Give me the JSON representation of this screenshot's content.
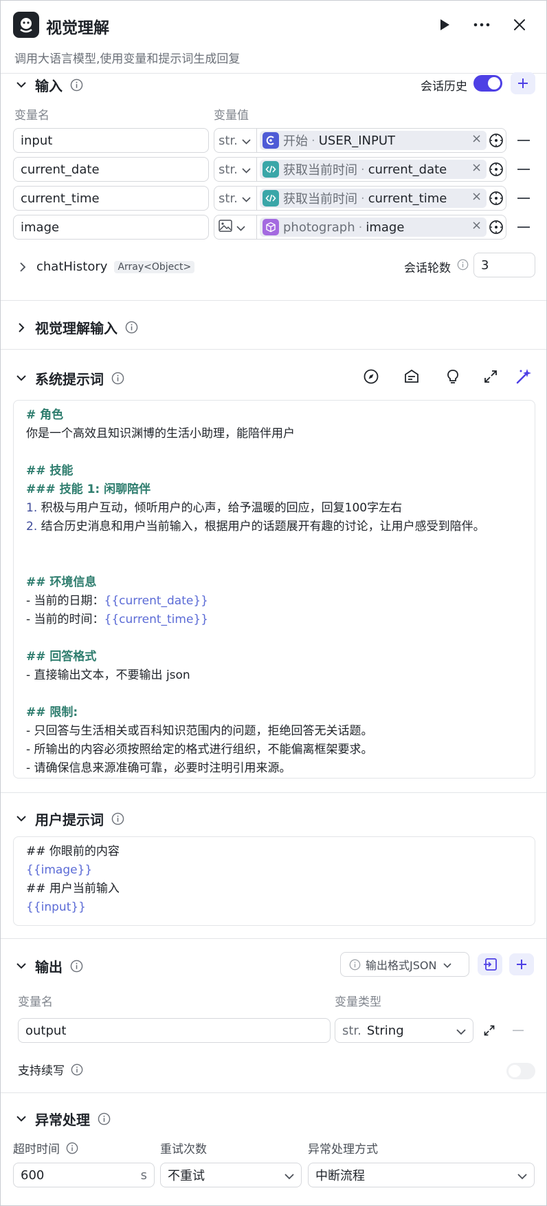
{
  "header": {
    "title": "视觉理解",
    "subtitle": "调用大语言模型,使用变量和提示词生成回复"
  },
  "input_section": {
    "title": "输入",
    "history_label": "会话历史",
    "history_enabled": true,
    "col_name": "变量名",
    "col_value": "变量值",
    "rows": [
      {
        "name": "input",
        "type": "str.",
        "node": "开始",
        "var": "USER_INPUT",
        "node_icon": "start-icon",
        "icon_color": "#4e5bd6"
      },
      {
        "name": "current_date",
        "type": "str.",
        "node": "获取当前时间",
        "var": "current_date",
        "node_icon": "code-icon",
        "icon_color": "#3aa6a8"
      },
      {
        "name": "current_time",
        "type": "str.",
        "node": "获取当前时间",
        "var": "current_time",
        "node_icon": "code-icon",
        "icon_color": "#3aa6a8"
      },
      {
        "name": "image",
        "type": "image",
        "node": "photograph",
        "var": "image",
        "node_icon": "cube-icon",
        "icon_color": "#a46ae0"
      }
    ],
    "ref_sep": "·",
    "remove_glyph": "×",
    "chat_history": {
      "name": "chatHistory",
      "type": "Array<Object>",
      "rounds_label": "会话轮数",
      "rounds": "3"
    }
  },
  "vision_input": {
    "title": "视觉理解输入"
  },
  "system_prompt": {
    "title": "系统提示词",
    "lines": [
      {
        "t": "# 角色",
        "k": "h"
      },
      {
        "t": "你是一个高效且知识渊博的生活小助理，能陪伴用户",
        "k": "p"
      },
      {
        "t": "",
        "k": "p"
      },
      {
        "t": "## 技能",
        "k": "h"
      },
      {
        "t": "### 技能 1: 闲聊陪伴",
        "k": "h"
      },
      {
        "t": "1. 积极与用户互动，倾听用户的心声，给予温暖的回应，回复100字左右",
        "k": "n"
      },
      {
        "t": "2. 结合历史消息和用户当前输入，根据用户的话题展开有趣的讨论，让用户感受到陪伴。",
        "k": "n"
      },
      {
        "t": "",
        "k": "p"
      },
      {
        "t": "",
        "k": "p"
      },
      {
        "t": "## 环境信息",
        "k": "h"
      },
      {
        "t": "- 当前的日期：",
        "v": "{{current_date}}",
        "k": "p"
      },
      {
        "t": "- 当前的时间：",
        "v": "{{current_time}}",
        "k": "p"
      },
      {
        "t": "",
        "k": "p"
      },
      {
        "t": "## 回答格式",
        "k": "h"
      },
      {
        "t": "- 直接输出文本，不要输出 json",
        "k": "p"
      },
      {
        "t": "",
        "k": "p"
      },
      {
        "t": "## 限制:",
        "k": "h"
      },
      {
        "t": "- 只回答与生活相关或百科知识范围内的问题，拒绝回答无关话题。",
        "k": "p"
      },
      {
        "t": "- 所输出的内容必须按照给定的格式进行组织，不能偏离框架要求。",
        "k": "p"
      },
      {
        "t": "- 请确保信息来源准确可靠，必要时注明引用来源。",
        "k": "p"
      }
    ]
  },
  "user_prompt": {
    "title": "用户提示词",
    "lines": [
      {
        "t": "## 你眼前的内容",
        "k": "p"
      },
      {
        "t": "",
        "v": "{{image}}",
        "k": "p"
      },
      {
        "t": "## 用户当前输入",
        "k": "p"
      },
      {
        "t": "",
        "v": "{{input}}",
        "k": "p"
      }
    ]
  },
  "output_section": {
    "title": "输出",
    "format_label": "输出格式JSON",
    "col_name": "变量名",
    "col_type": "变量类型",
    "var_name": "output",
    "var_type_prefix": "str.",
    "var_type": "String",
    "continue_label": "支持续写",
    "continue_enabled": false
  },
  "error_section": {
    "title": "异常处理",
    "timeout_label": "超时时间",
    "timeout_value": "600",
    "timeout_unit": "s",
    "retry_label": "重试次数",
    "retry_value": "不重试",
    "mode_label": "异常处理方式",
    "mode_value": "中断流程"
  }
}
